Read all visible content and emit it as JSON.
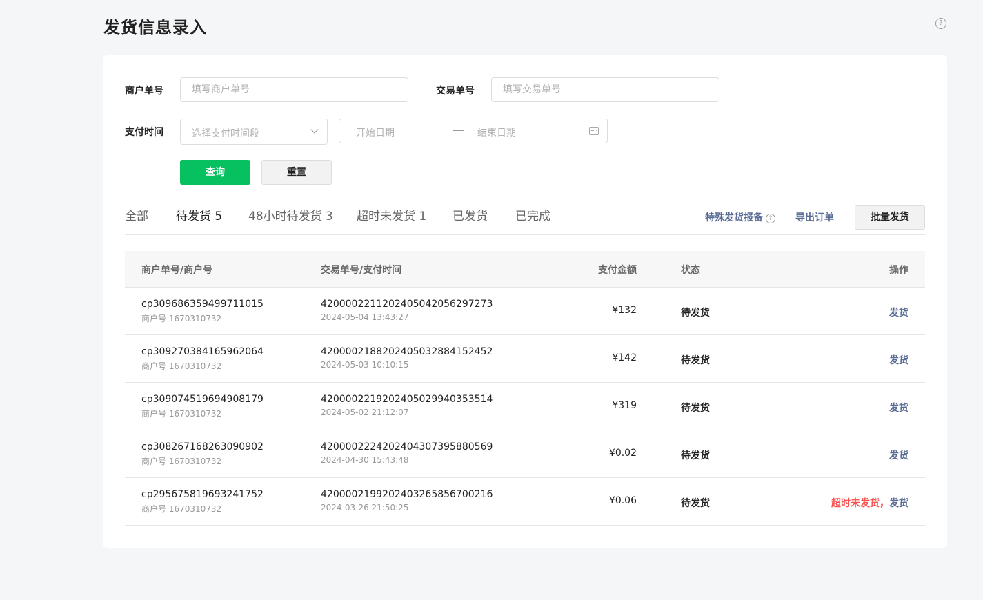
{
  "page": {
    "title": "发货信息录入"
  },
  "colors": {
    "primary": "#07c160",
    "link": "#576b95",
    "warning": "#fa5151"
  },
  "filters": {
    "merchant_no_label": "商户单号",
    "merchant_no_placeholder": "填写商户单号",
    "trade_no_label": "交易单号",
    "trade_no_placeholder": "填写交易单号",
    "pay_time_label": "支付时间",
    "pay_time_select_placeholder": "选择支付时间段",
    "start_date_placeholder": "开始日期",
    "end_date_placeholder": "结束日期",
    "query_button": "查询",
    "reset_button": "重置"
  },
  "tabs": [
    {
      "label": "全部",
      "active": false
    },
    {
      "label": "待发货 5",
      "active": true
    },
    {
      "label": "48小时待发货 3",
      "active": false
    },
    {
      "label": "超时未发货 1",
      "active": false
    },
    {
      "label": "已发货",
      "active": false
    },
    {
      "label": "已完成",
      "active": false
    }
  ],
  "actions": {
    "special_report": "特殊发货报备",
    "export": "导出订单",
    "batch_ship": "批量发货"
  },
  "table": {
    "headers": {
      "merchant": "商户单号/商户号",
      "trade": "交易单号/支付时间",
      "amount": "支付金额",
      "status": "状态",
      "op": "操作"
    },
    "rows": [
      {
        "merchant_order": "cp309686359499711015",
        "merchant_id": "商户号 1670310732",
        "trade_no": "4200002211202405042056297273",
        "pay_time": "2024-05-04 13:43:27",
        "amount": "¥132",
        "status": "待发货",
        "warning": "",
        "op": "发货"
      },
      {
        "merchant_order": "cp309270384165962064",
        "merchant_id": "商户号 1670310732",
        "trade_no": "4200002188202405032884152452",
        "pay_time": "2024-05-03 10:10:15",
        "amount": "¥142",
        "status": "待发货",
        "warning": "",
        "op": "发货"
      },
      {
        "merchant_order": "cp309074519694908179",
        "merchant_id": "商户号 1670310732",
        "trade_no": "4200002219202405029940353514",
        "pay_time": "2024-05-02 21:12:07",
        "amount": "¥319",
        "status": "待发货",
        "warning": "",
        "op": "发货"
      },
      {
        "merchant_order": "cp308267168263090902",
        "merchant_id": "商户号 1670310732",
        "trade_no": "4200002224202404307395880569",
        "pay_time": "2024-04-30 15:43:48",
        "amount": "¥0.02",
        "status": "待发货",
        "warning": "",
        "op": "发货"
      },
      {
        "merchant_order": "cp295675819693241752",
        "merchant_id": "商户号 1670310732",
        "trade_no": "4200002199202403265856700216",
        "pay_time": "2024-03-26 21:50:25",
        "amount": "¥0.06",
        "status": "待发货",
        "warning": "超时未发货，",
        "op": "发货"
      }
    ]
  }
}
